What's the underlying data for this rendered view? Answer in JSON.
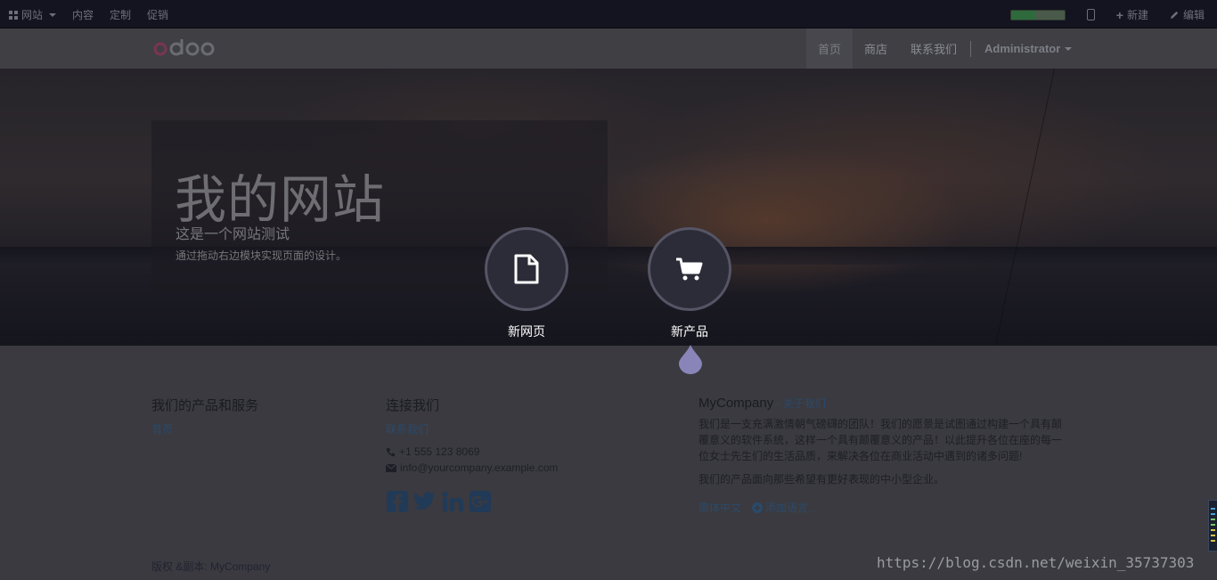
{
  "adminbar": {
    "website_menu": "网站",
    "content": "内容",
    "customize": "定制",
    "promote": "促销",
    "new": "新建",
    "edit": "编辑",
    "progress_fraction": 0.45
  },
  "navbar": {
    "brand": "odoo",
    "links": [
      {
        "label": "首页",
        "active": true
      },
      {
        "label": "商店",
        "active": false
      },
      {
        "label": "联系我们",
        "active": false
      }
    ],
    "user": "Administrator"
  },
  "hero": {
    "title": "我的网站",
    "subtitle": "这是一个网站测试",
    "description": "通过拖动右边模块实现页面的设计。"
  },
  "actions": {
    "new_page": "新网页",
    "new_product": "新产品"
  },
  "footer": {
    "products_heading": "我们的产品和服务",
    "products_link": "首页",
    "connect_heading": "连接我们",
    "contact_link": "联系我们",
    "phone": "+1 555 123 8069",
    "email": "info@yourcompany.example.com",
    "company_name": "MyCompany",
    "about_link": "- 关于我们",
    "about_text": "我们是一支充满激情朝气磅礴的团队！我们的愿景是试图通过构建一个具有颠覆意义的软件系统，这样一个具有颠覆意义的产品！以此提升各位在座的每一位女士先生们的生活品质，来解决各位在商业活动中遇到的诸多问题!",
    "target_text": "我们的产品面向那些希望有更好表现的中小型企业。",
    "language": "简体中文",
    "add_language": "添加语言...",
    "copyright": "版权 &副本: MyCompany"
  },
  "watermark": "https://blog.csdn.net/weixin_35737303"
}
